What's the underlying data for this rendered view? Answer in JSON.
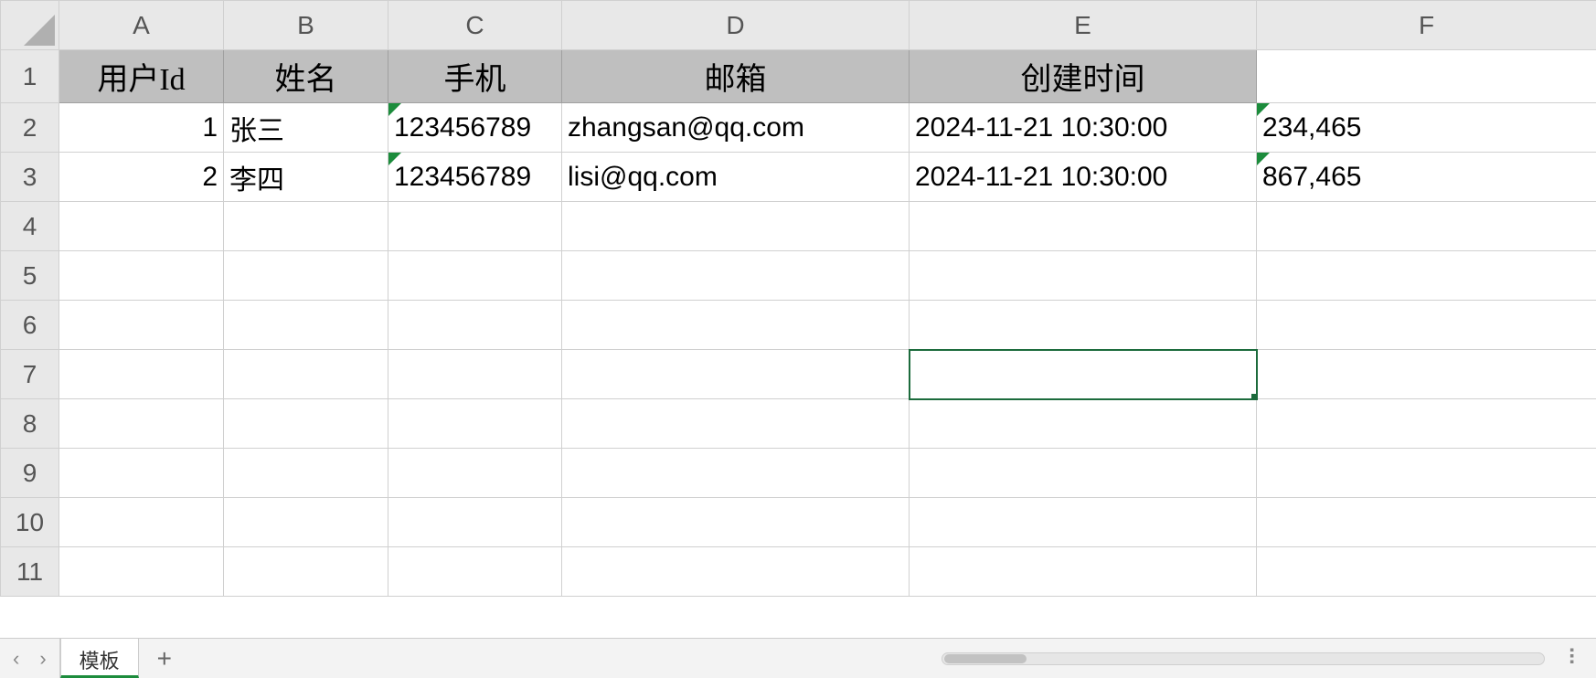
{
  "columns": [
    "A",
    "B",
    "C",
    "D",
    "E",
    "F"
  ],
  "row_numbers": [
    "1",
    "2",
    "3",
    "4",
    "5",
    "6",
    "7",
    "8",
    "9",
    "10",
    "11"
  ],
  "headers": {
    "A": "用户Id",
    "B": "姓名",
    "C": "手机",
    "D": "邮箱",
    "E": "创建时间"
  },
  "rows": [
    {
      "A": "1",
      "B": "张三",
      "C": "123456789",
      "D": "zhangsan@qq.com",
      "E": "2024-11-21 10:30:00",
      "F": "234,465"
    },
    {
      "A": "2",
      "B": "李四",
      "C": "123456789",
      "D": "lisi@qq.com",
      "E": "2024-11-21 10:30:00",
      "F": "867,465"
    }
  ],
  "active_cell": "E7",
  "sheet_tab": "模板",
  "nav": {
    "prev": "‹",
    "next": "›",
    "add": "+"
  }
}
